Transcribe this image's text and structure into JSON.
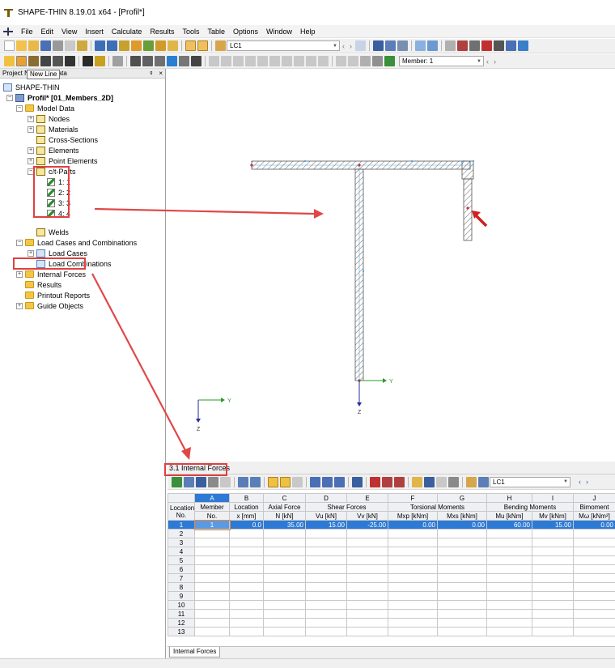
{
  "window": {
    "title": "SHAPE-THIN 8.19.01 x64 - [Profil*]"
  },
  "menu": [
    "File",
    "Edit",
    "View",
    "Insert",
    "Calculate",
    "Results",
    "Tools",
    "Table",
    "Options",
    "Window",
    "Help"
  ],
  "toolbar1": {
    "load_case": "LC1"
  },
  "toolbar2": {
    "member_combo": "Member: 1"
  },
  "tooltip": "New Line",
  "panel": {
    "title_left": "Project N",
    "title_right": "Data",
    "pin": "ᵍ",
    "close": "×"
  },
  "tree": {
    "root": "SHAPE-THIN",
    "project": "Profil* [01_Members_2D]",
    "model_data": "Model Data",
    "nodes": "Nodes",
    "materials": "Materials",
    "cross_sections": "Cross-Sections",
    "elements": "Elements",
    "point_elements": "Point Elements",
    "ct_parts": "c/t-Parts",
    "parts": [
      "1: 1",
      "2: 2",
      "3: 3",
      "4: 4"
    ],
    "welds": "Welds",
    "load_cases_combos": "Load Cases and Combinations",
    "load_cases": "Load Cases",
    "load_combinations": "Load Combinations",
    "internal_forces": "Internal Forces",
    "results": "Results",
    "printout_reports": "Printout Reports",
    "guide_objects": "Guide Objects"
  },
  "canvas": {
    "axis_y": "Y",
    "axis_z": "Z"
  },
  "table": {
    "section_title": "3.1 Internal Forces",
    "load_case": "LC1",
    "col_letters": [
      "A",
      "B",
      "C",
      "D",
      "E",
      "F",
      "G",
      "H",
      "I",
      "J"
    ],
    "group_headers": {
      "location": "Location",
      "location_no": "No.",
      "member": "Member",
      "member_no": "No.",
      "loc": "Location",
      "loc_unit": "x [mm]",
      "axial": "Axial Force",
      "axial_unit": "N [kN]",
      "shear": "Shear Forces",
      "shear_u": "Vu [kN]",
      "shear_v": "Vv [kN]",
      "torsion": "Torsional Moments",
      "torsion_p": "Mxp [kNm]",
      "torsion_s": "Mxs [kNm]",
      "bending": "Bending Moments",
      "bending_u": "Mu [kNm]",
      "bending_v": "Mv [kNm]",
      "bimoment": "Bimoment",
      "bimoment_unit": "Mω [kNm²]"
    },
    "rows": [
      [
        "1",
        "1",
        "0.0",
        "35.00",
        "15.00",
        "-25.00",
        "0.00",
        "0.00",
        "60.00",
        "15.00",
        "0.00"
      ],
      [
        "2",
        "",
        "",
        "",
        "",
        "",
        "",
        "",
        "",
        "",
        ""
      ],
      [
        "3",
        "",
        "",
        "",
        "",
        "",
        "",
        "",
        "",
        "",
        ""
      ],
      [
        "4",
        "",
        "",
        "",
        "",
        "",
        "",
        "",
        "",
        "",
        ""
      ],
      [
        "5",
        "",
        "",
        "",
        "",
        "",
        "",
        "",
        "",
        "",
        ""
      ],
      [
        "6",
        "",
        "",
        "",
        "",
        "",
        "",
        "",
        "",
        "",
        ""
      ],
      [
        "7",
        "",
        "",
        "",
        "",
        "",
        "",
        "",
        "",
        "",
        ""
      ],
      [
        "8",
        "",
        "",
        "",
        "",
        "",
        "",
        "",
        "",
        "",
        ""
      ],
      [
        "9",
        "",
        "",
        "",
        "",
        "",
        "",
        "",
        "",
        "",
        ""
      ],
      [
        "10",
        "",
        "",
        "",
        "",
        "",
        "",
        "",
        "",
        "",
        ""
      ],
      [
        "11",
        "",
        "",
        "",
        "",
        "",
        "",
        "",
        "",
        "",
        ""
      ],
      [
        "12",
        "",
        "",
        "",
        "",
        "",
        "",
        "",
        "",
        "",
        ""
      ],
      [
        "13",
        "",
        "",
        "",
        "",
        "",
        "",
        "",
        "",
        "",
        ""
      ]
    ],
    "tab": "Internal Forces"
  }
}
